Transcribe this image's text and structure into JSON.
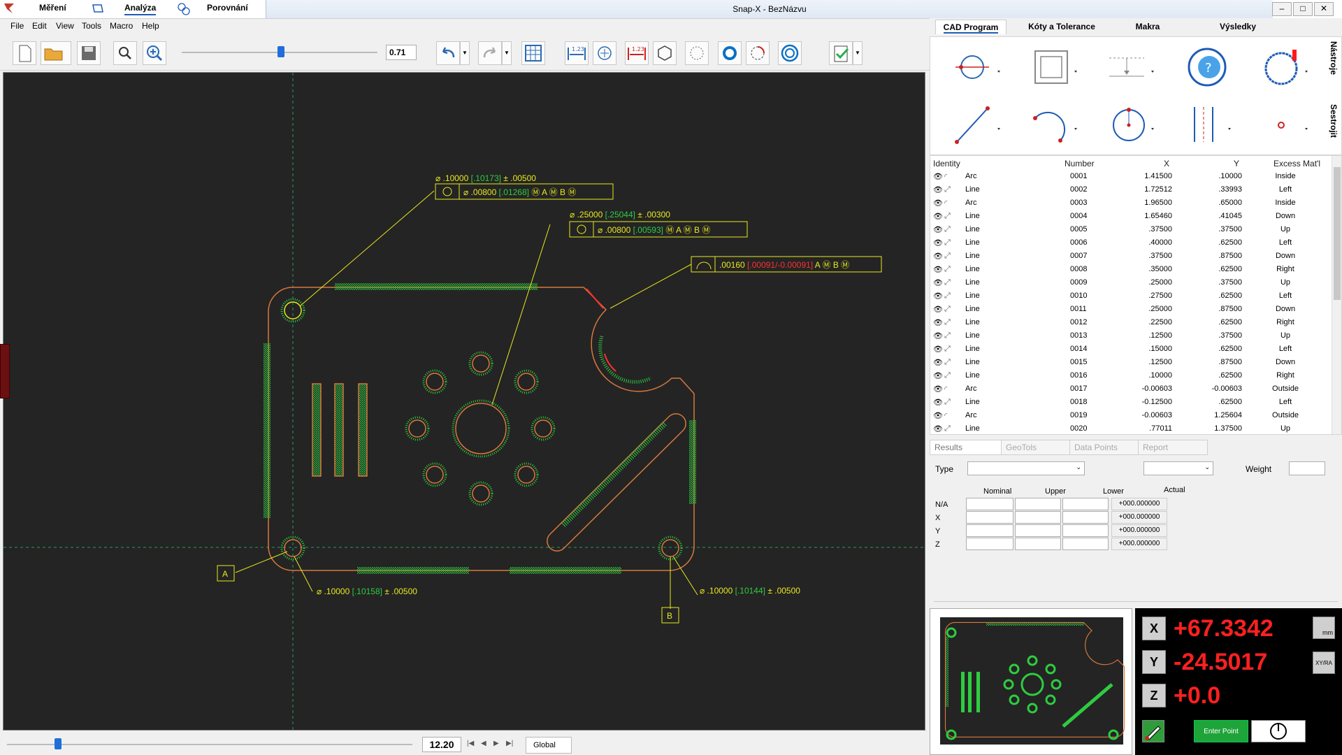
{
  "app": {
    "title": "Snap-X - BezNázvu",
    "modes": [
      "Měření",
      "Analýza",
      "Porovnání"
    ],
    "active_mode": "Analýza",
    "window_buttons": [
      "–",
      "□",
      "✕"
    ]
  },
  "menu": [
    "File",
    "Edit",
    "View",
    "Tools",
    "Macro",
    "Help"
  ],
  "toolbar": {
    "zoom_value": "0.71"
  },
  "cad": {
    "annotations": {
      "dia1_top": "⌀ .10000",
      "dia1_meas": "[.10173]",
      "dia1_tol": "± .00500",
      "fcf1_val": ".00800",
      "fcf1_meas": "[.01268]",
      "dia2_top": "⌀ .25000",
      "dia2_meas": "[.25044]",
      "dia2_tol": "± .00300",
      "fcf2_val": ".00800",
      "fcf2_meas": "[.00593]",
      "profile_val": ".00160",
      "profile_meas": "[.00091/-0.00091]",
      "datum_a": "A",
      "datum_b": "B",
      "mod_m": "M",
      "dia3": "⌀ .10000",
      "dia3_meas": "[.10158]",
      "dia3_tol": "± .00500",
      "dia4": "⌀ .10000",
      "dia4_meas": "[.10144]",
      "dia4_tol": "± .00500"
    }
  },
  "bottom": {
    "scale_value": "12.20",
    "tab": "Global"
  },
  "right_tabs": [
    "CAD Program",
    "Kóty a Tolerance",
    "Makra",
    "Výsledky"
  ],
  "side_labels": [
    "Nástroje",
    "Sestrojit"
  ],
  "table": {
    "headers": [
      "Identity",
      "Number",
      "X",
      "Y",
      "Excess Mat'l"
    ],
    "rows": [
      {
        "type": "Arc",
        "num": "0001",
        "x": "1.41500",
        "y": ".10000",
        "ex": "Inside"
      },
      {
        "type": "Line",
        "num": "0002",
        "x": "1.72512",
        "y": ".33993",
        "ex": "Left"
      },
      {
        "type": "Arc",
        "num": "0003",
        "x": "1.96500",
        "y": ".65000",
        "ex": "Inside"
      },
      {
        "type": "Line",
        "num": "0004",
        "x": "1.65460",
        "y": ".41045",
        "ex": "Down"
      },
      {
        "type": "Line",
        "num": "0005",
        "x": ".37500",
        "y": ".37500",
        "ex": "Up"
      },
      {
        "type": "Line",
        "num": "0006",
        "x": ".40000",
        "y": ".62500",
        "ex": "Left"
      },
      {
        "type": "Line",
        "num": "0007",
        "x": ".37500",
        "y": ".87500",
        "ex": "Down"
      },
      {
        "type": "Line",
        "num": "0008",
        "x": ".35000",
        "y": ".62500",
        "ex": "Right"
      },
      {
        "type": "Line",
        "num": "0009",
        "x": ".25000",
        "y": ".37500",
        "ex": "Up"
      },
      {
        "type": "Line",
        "num": "0010",
        "x": ".27500",
        "y": ".62500",
        "ex": "Left"
      },
      {
        "type": "Line",
        "num": "0011",
        "x": ".25000",
        "y": ".87500",
        "ex": "Down"
      },
      {
        "type": "Line",
        "num": "0012",
        "x": ".22500",
        "y": ".62500",
        "ex": "Right"
      },
      {
        "type": "Line",
        "num": "0013",
        "x": ".12500",
        "y": ".37500",
        "ex": "Up"
      },
      {
        "type": "Line",
        "num": "0014",
        "x": ".15000",
        "y": ".62500",
        "ex": "Left"
      },
      {
        "type": "Line",
        "num": "0015",
        "x": ".12500",
        "y": ".87500",
        "ex": "Down"
      },
      {
        "type": "Line",
        "num": "0016",
        "x": ".10000",
        "y": ".62500",
        "ex": "Right"
      },
      {
        "type": "Arc",
        "num": "0017",
        "x": "-0.00603",
        "y": "-0.00603",
        "ex": "Outside"
      },
      {
        "type": "Line",
        "num": "0018",
        "x": "-0.12500",
        "y": ".62500",
        "ex": "Left"
      },
      {
        "type": "Arc",
        "num": "0019",
        "x": "-0.00603",
        "y": "1.25604",
        "ex": "Outside"
      },
      {
        "type": "Line",
        "num": "0020",
        "x": ".77011",
        "y": "1.37500",
        "ex": "Up"
      }
    ]
  },
  "results": {
    "tabs": [
      "Results",
      "GeoTols",
      "Data Points",
      "Report"
    ],
    "type_label": "Type",
    "weight_label": "Weight",
    "cols": [
      "Nominal",
      "Upper",
      "Lower",
      "Actual"
    ],
    "rows": [
      {
        "label": "N/A",
        "actual": "+000.000000"
      },
      {
        "label": "X",
        "actual": "+000.000000"
      },
      {
        "label": "Y",
        "actual": "+000.000000"
      },
      {
        "label": "Z",
        "actual": "+000.000000"
      }
    ]
  },
  "dro": {
    "x_label": "X",
    "x_value": "+67.3342",
    "y_label": "Y",
    "y_value": "-24.5017",
    "z_label": "Z",
    "z_value": "+0.0",
    "unit_btn": "mm",
    "coord_btn": "XY/RA",
    "enter_point": "Enter Point"
  },
  "colors": {
    "cad_bg": "#242424",
    "geometry": "#d8783c",
    "points": "#2ecc40",
    "annotation": "#e8e820",
    "dro_value": "#ff2020"
  }
}
